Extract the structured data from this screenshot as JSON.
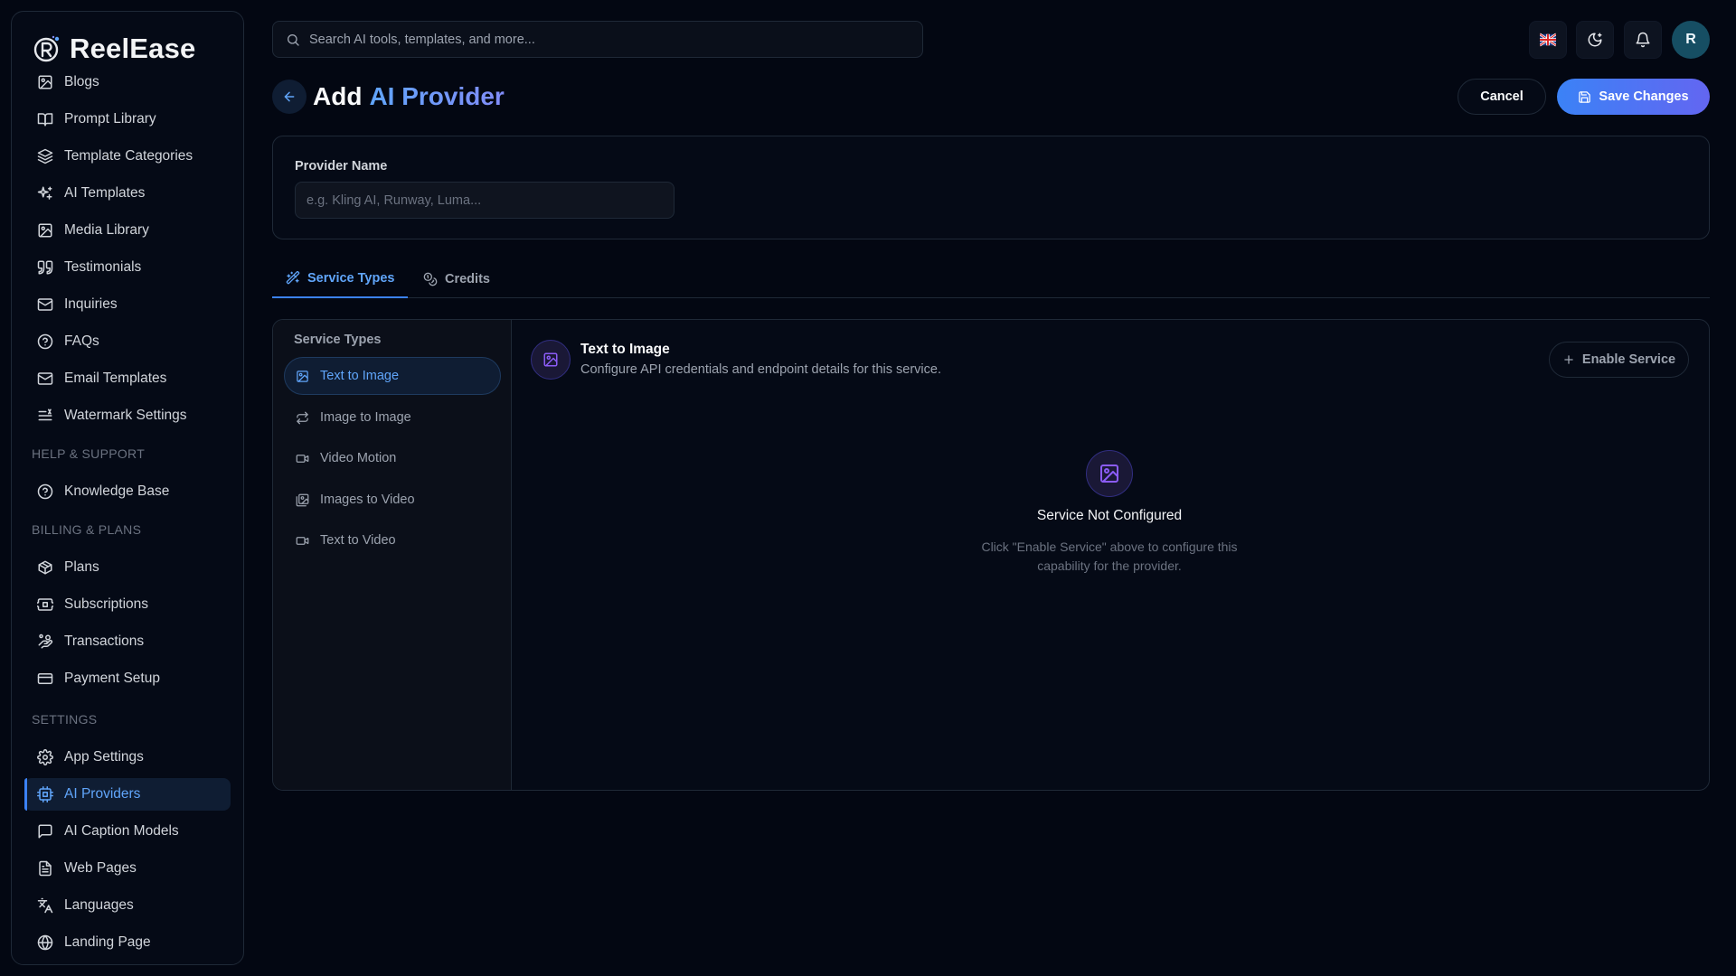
{
  "brand": {
    "name": "ReelEase"
  },
  "sidebar": {
    "items": [
      {
        "label": "Blogs",
        "icon": "image-icon"
      },
      {
        "label": "Prompt Library",
        "icon": "book-open-icon"
      },
      {
        "label": "Template Categories",
        "icon": "layers-icon"
      },
      {
        "label": "AI Templates",
        "icon": "sparkles-icon"
      },
      {
        "label": "Media Library",
        "icon": "image-icon"
      },
      {
        "label": "Testimonials",
        "icon": "quote-icon"
      },
      {
        "label": "Inquiries",
        "icon": "mail-icon"
      },
      {
        "label": "FAQs",
        "icon": "help-circle-icon"
      },
      {
        "label": "Email Templates",
        "icon": "mail-icon"
      },
      {
        "label": "Watermark Settings",
        "icon": "text-lines-icon"
      }
    ],
    "sections": {
      "help": "HELP & SUPPORT",
      "billing": "BILLING & PLANS",
      "settings": "SETTINGS"
    },
    "help_items": [
      {
        "label": "Knowledge Base",
        "icon": "help-circle-icon"
      }
    ],
    "billing_items": [
      {
        "label": "Plans",
        "icon": "package-icon"
      },
      {
        "label": "Subscriptions",
        "icon": "ticket-icon"
      },
      {
        "label": "Transactions",
        "icon": "coins-icon"
      },
      {
        "label": "Payment Setup",
        "icon": "credit-card-icon"
      }
    ],
    "settings_items": [
      {
        "label": "App Settings",
        "icon": "gear-icon"
      },
      {
        "label": "AI Providers",
        "icon": "cpu-icon",
        "active": true
      },
      {
        "label": "AI Caption Models",
        "icon": "message-square-icon"
      },
      {
        "label": "Web Pages",
        "icon": "file-text-icon"
      },
      {
        "label": "Languages",
        "icon": "languages-icon"
      },
      {
        "label": "Landing Page",
        "icon": "globe-icon"
      }
    ]
  },
  "topbar": {
    "search_placeholder": "Search AI tools, templates, and more...",
    "avatar_initial": "R"
  },
  "header": {
    "title_prefix": "Add",
    "title_highlight": "AI Provider",
    "cancel_label": "Cancel",
    "save_label": "Save Changes"
  },
  "provider_form": {
    "name_label": "Provider Name",
    "name_placeholder": "e.g. Kling AI, Runway, Luma...",
    "name_value": ""
  },
  "tabs": [
    {
      "label": "Service Types",
      "active": true
    },
    {
      "label": "Credits",
      "active": false
    }
  ],
  "services": {
    "list_title": "Service Types",
    "items": [
      {
        "label": "Text to Image",
        "active": true
      },
      {
        "label": "Image to Image",
        "active": false
      },
      {
        "label": "Video Motion",
        "active": false
      },
      {
        "label": "Images to Video",
        "active": false
      },
      {
        "label": "Text to Video",
        "active": false
      }
    ],
    "detail": {
      "title": "Text to Image",
      "description": "Configure API credentials and endpoint details for this service.",
      "enable_label": "Enable Service",
      "empty_title": "Service Not Configured",
      "empty_description": "Click \"Enable Service\" above to configure this capability for the provider."
    }
  },
  "colors": {
    "background": "#030712",
    "accent": "#3b82f6",
    "accent_secondary": "#6366f1",
    "active_text": "#60a5fa",
    "icon_purple": "#8b5cf6"
  }
}
